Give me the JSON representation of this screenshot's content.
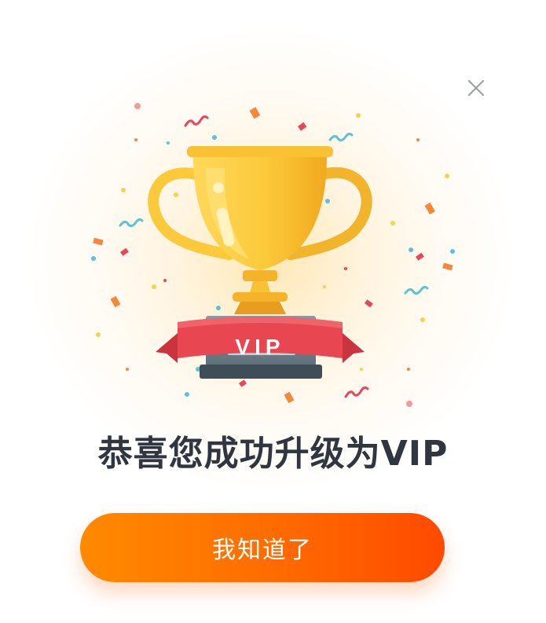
{
  "dialog": {
    "badge_text": "VIP",
    "headline": "恭喜您成功升级为VIP",
    "confirm_label": "我知道了"
  },
  "colors": {
    "button_start": "#ff8a00",
    "button_end": "#ff4a00",
    "trophy_gold": "#f8c234",
    "ribbon_red": "#e84650",
    "headline_text": "#2f3640"
  },
  "icons": {
    "close": "close-icon",
    "trophy": "trophy-icon"
  }
}
